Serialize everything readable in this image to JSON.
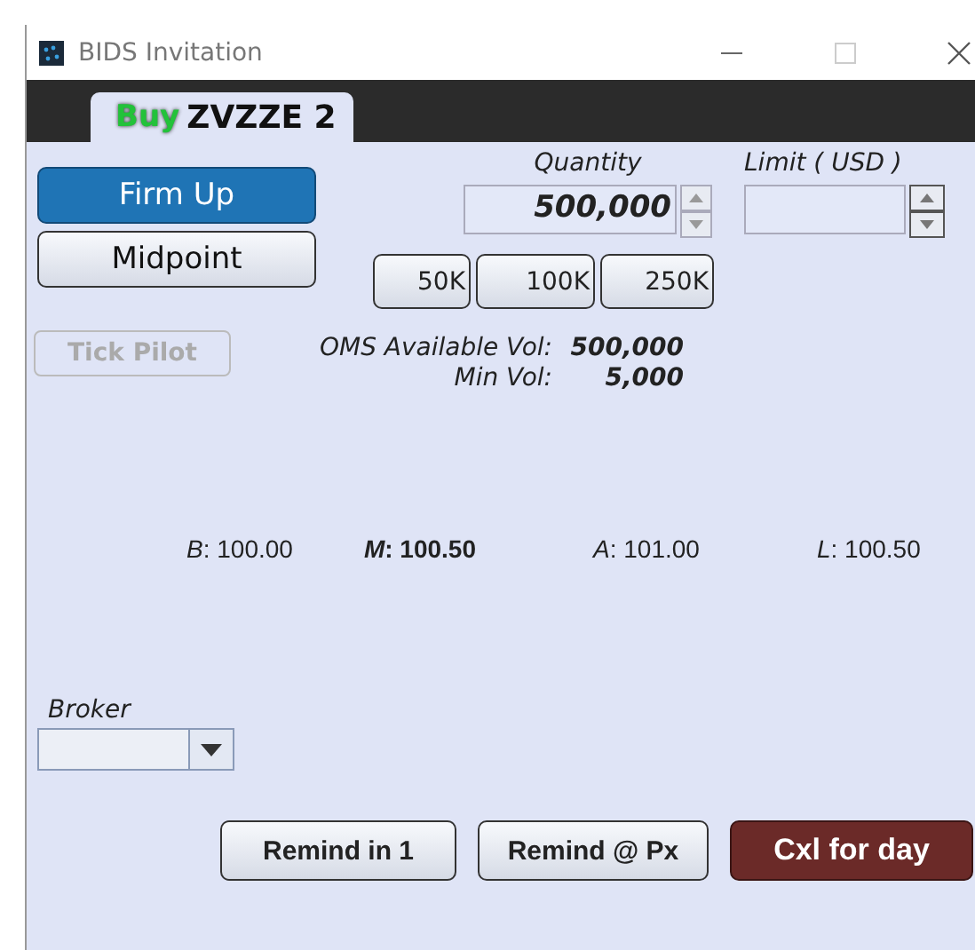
{
  "window": {
    "title": "BIDS Invitation"
  },
  "tab": {
    "side": "Buy",
    "symbol": "ZVZZE 2",
    "selected": true
  },
  "mode_buttons": [
    {
      "label": "Firm Up",
      "selected": true
    },
    {
      "label": "Midpoint",
      "selected": false
    }
  ],
  "tick_pilot": {
    "label": "Tick Pilot",
    "disabled": true
  },
  "quantity": {
    "label": "Quantity",
    "value": "500,000"
  },
  "limit": {
    "label": "Limit ( USD )"
  },
  "quick_sizes": [
    "50K",
    "100K",
    "250K"
  ],
  "volumes": [
    {
      "label": "OMS Available Vol:",
      "value": "500,000"
    },
    {
      "label": "Min Vol:",
      "value": "5,000"
    }
  ],
  "prices": [
    {
      "text": "*B*: 100.00",
      "bold": false
    },
    {
      "text": "*M*: 100.50",
      "bold": true
    },
    {
      "text": "*A*: 101.00",
      "bold": false
    },
    {
      "text": "*L*: 100.50",
      "bold": false
    }
  ],
  "broker": {
    "label": "Broker"
  },
  "actions": [
    {
      "label": "Remind in 1",
      "kind": "normal"
    },
    {
      "label": "Remind @ Px",
      "kind": "normal"
    },
    {
      "label": "Cxl for day",
      "kind": "danger"
    }
  ]
}
